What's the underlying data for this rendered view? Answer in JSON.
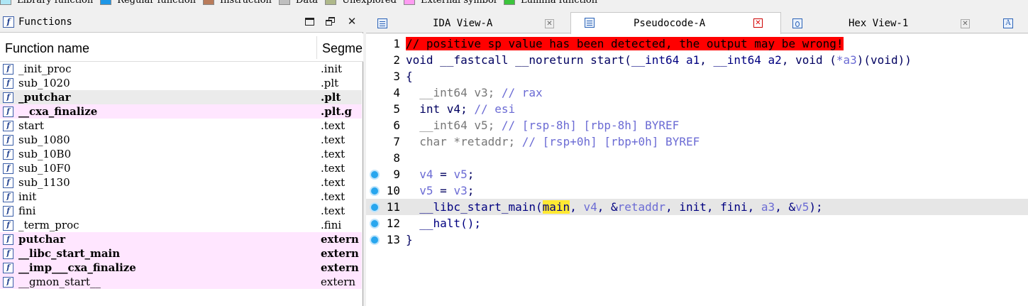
{
  "legend": [
    {
      "label": "Library function",
      "color": "#aee6f5"
    },
    {
      "label": "Regular function",
      "color": "#1e96e6"
    },
    {
      "label": "Instruction",
      "color": "#b97b5a"
    },
    {
      "label": "Data",
      "color": "#bfbfbf"
    },
    {
      "label": "Unexplored",
      "color": "#aeb88a"
    },
    {
      "label": "External symbol",
      "color": "#ff9cf2"
    },
    {
      "label": "Lumina function",
      "color": "#3cc43c"
    }
  ],
  "functions_panel": {
    "title": "Functions",
    "icon": "function-icon",
    "col_name": "Function name",
    "col_segment": "Segme",
    "rows": [
      {
        "name": "_init_proc",
        "segment": ".init",
        "style": "normal"
      },
      {
        "name": "sub_1020",
        "segment": ".plt",
        "style": "normal"
      },
      {
        "name": "_putchar",
        "segment": ".plt",
        "style": "bold-grey"
      },
      {
        "name": "__cxa_finalize",
        "segment": ".plt.g",
        "style": "bold-pink"
      },
      {
        "name": "start",
        "segment": ".text",
        "style": "normal"
      },
      {
        "name": "sub_1080",
        "segment": ".text",
        "style": "normal"
      },
      {
        "name": "sub_10B0",
        "segment": ".text",
        "style": "normal"
      },
      {
        "name": "sub_10F0",
        "segment": ".text",
        "style": "normal"
      },
      {
        "name": "sub_1130",
        "segment": ".text",
        "style": "normal"
      },
      {
        "name": "init",
        "segment": ".text",
        "style": "normal"
      },
      {
        "name": "fini",
        "segment": ".text",
        "style": "normal"
      },
      {
        "name": "_term_proc",
        "segment": ".fini",
        "style": "normal"
      },
      {
        "name": "putchar",
        "segment": "extern",
        "style": "bold-pink"
      },
      {
        "name": "__libc_start_main",
        "segment": "extern",
        "style": "bold-pink"
      },
      {
        "name": "__imp___cxa_finalize",
        "segment": "extern",
        "style": "bold-pink"
      },
      {
        "name": "__gmon_start__",
        "segment": "extern",
        "style": "pink"
      }
    ]
  },
  "tabs": [
    {
      "label": "IDA View-A",
      "icon": "disassembly-icon",
      "active": false
    },
    {
      "label": "Pseudocode-A",
      "icon": "pseudocode-icon",
      "active": true
    },
    {
      "label": "Hex View-1",
      "icon": "hex-icon",
      "active": false
    },
    {
      "label": "A",
      "icon": "strings-icon",
      "active": false
    }
  ],
  "code": {
    "line_numbers": [
      "1",
      "2",
      "3",
      "4",
      "5",
      "6",
      "7",
      "8",
      "9",
      "10",
      "11",
      "12",
      "13"
    ],
    "lines": {
      "l1": "// positive sp value has been detected, the output may be wrong!",
      "l2a": "void __fastcall __noreturn start(",
      "l2b": "__int64 a1",
      "l2c": ", ",
      "l2d": "__int64 a2",
      "l2e": ", void (",
      "l2f": "*a3",
      "l2g": ")(void))",
      "l3": "{",
      "l4a": "  __int64 v3; ",
      "l4b": "// rax",
      "l5a": "  int v4; ",
      "l5b": "// esi",
      "l6a": "  __int64 v5; ",
      "l6b": "// [rsp-8h] [rbp-8h] BYREF",
      "l7a": "  char *retaddr; ",
      "l7b": "// [rsp+0h] [rbp+0h] BYREF",
      "l9a": "  ",
      "l9b": "v4",
      "l9c": " = ",
      "l9d": "v5",
      "l9e": ";",
      "l10a": "  ",
      "l10b": "v5",
      "l10c": " = ",
      "l10d": "v3",
      "l10e": ";",
      "l11a": "  __libc_start_main(",
      "l11b": "main",
      "l11c": ", ",
      "l11d": "v4",
      "l11e": ", &",
      "l11f": "retaddr",
      "l11g": ", init, fini, ",
      "l11h": "a3",
      "l11i": ", &",
      "l11j": "v5",
      "l11k": ");",
      "l12": "  __halt();",
      "l13": "}"
    },
    "breakpoint_lines": [
      "9",
      "10",
      "11",
      "12",
      "13"
    ],
    "highlighted_line": "11"
  }
}
